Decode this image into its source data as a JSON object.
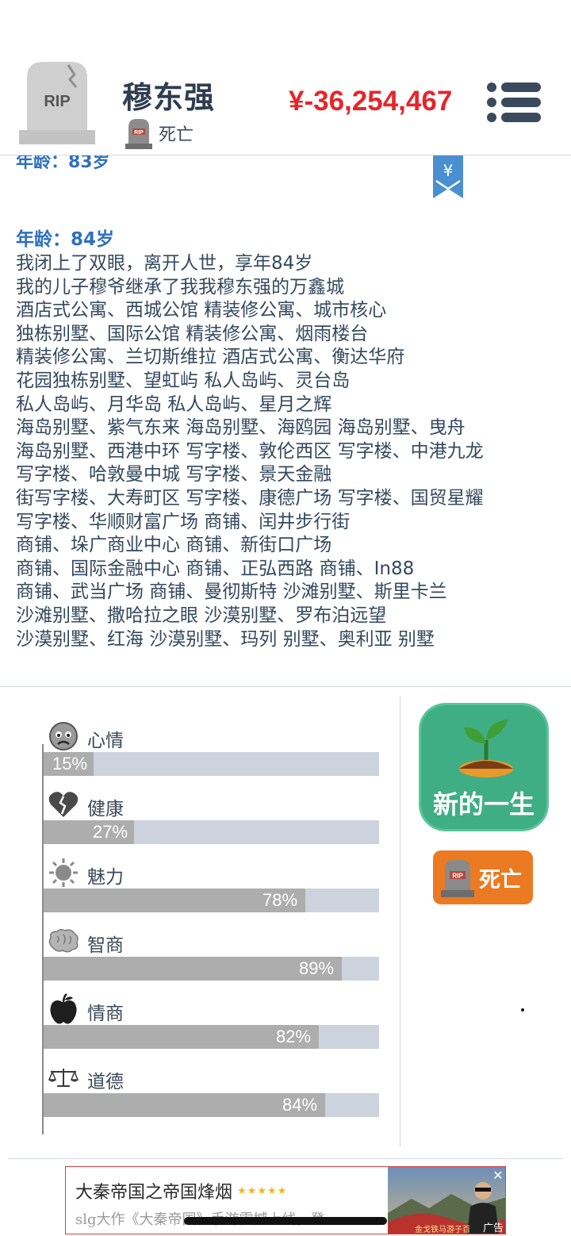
{
  "header": {
    "tomb_text": "RIP",
    "name": "穆东强",
    "status": "死亡",
    "money": "¥-36,254,467"
  },
  "log": {
    "cut_line": "年龄：83岁",
    "bookmark_symbol": "¥",
    "age_title": "年龄：84岁",
    "lines": [
      "我闭上了双眼，离开人世，享年84岁",
      "我的儿子穆爷继承了我我穆东强的万鑫城",
      "酒店式公寓、西城公馆 精装修公寓、城市核心",
      "独栋别墅、国际公馆 精装修公寓、烟雨楼台",
      "精装修公寓、兰切斯维拉 酒店式公寓、衡达华府",
      "花园独栋别墅、望虹屿 私人岛屿、灵台岛",
      "私人岛屿、月华岛 私人岛屿、星月之辉",
      "海岛别墅、紫气东来 海岛别墅、海鸥园 海岛别墅、曳舟",
      "海岛别墅、西港中环 写字楼、敦伦西区 写字楼、中港九龙",
      "写字楼、哈敦曼中城 写字楼、景天金融",
      "街写字楼、大寿町区 写字楼、康德广场 写字楼、国贸星耀",
      "写字楼、华顺财富广场 商铺、闰井步行街",
      "商铺、垛广商业中心 商铺、新街口广场",
      "商铺、国际金融中心 商铺、正弘西路 商铺、In88",
      "商铺、武当广场 商铺、曼彻斯特 沙滩别墅、斯里卡兰",
      "沙滩别墅、撒哈拉之眼 沙漠别墅、罗布泊远望",
      "沙漠别墅、红海 沙漠别墅、玛列 别墅、奥利亚 别墅"
    ]
  },
  "stats": [
    {
      "label": "心情",
      "value": 15,
      "text": "15%",
      "icon": "sad-face-icon"
    },
    {
      "label": "健康",
      "value": 27,
      "text": "27%",
      "icon": "broken-heart-icon"
    },
    {
      "label": "魅力",
      "value": 78,
      "text": "78%",
      "icon": "sun-icon"
    },
    {
      "label": "智商",
      "value": 89,
      "text": "89%",
      "icon": "brain-icon"
    },
    {
      "label": "情商",
      "value": 82,
      "text": "82%",
      "icon": "apple-icon"
    },
    {
      "label": "道德",
      "value": 84,
      "text": "84%",
      "icon": "scales-icon"
    }
  ],
  "actions": {
    "new_life": "新的一生",
    "dead_label": "死亡",
    "dead_tomb_text": "RIP"
  },
  "ad": {
    "title": "大秦帝国之帝国烽烟",
    "stars": "★★★★★",
    "subtitle": "slg大作《大秦帝国》手游震撼上线，登",
    "caption": "金戈铁马游子百",
    "tag": "广告",
    "close": "✕"
  },
  "colors": {
    "money": "#e5262b",
    "age_title": "#2f6fbf",
    "new_life_bg": "#3fae85",
    "dead_bg": "#ec7a22",
    "bar_fill": "#adadad",
    "bar_track": "#cdd3dc"
  }
}
